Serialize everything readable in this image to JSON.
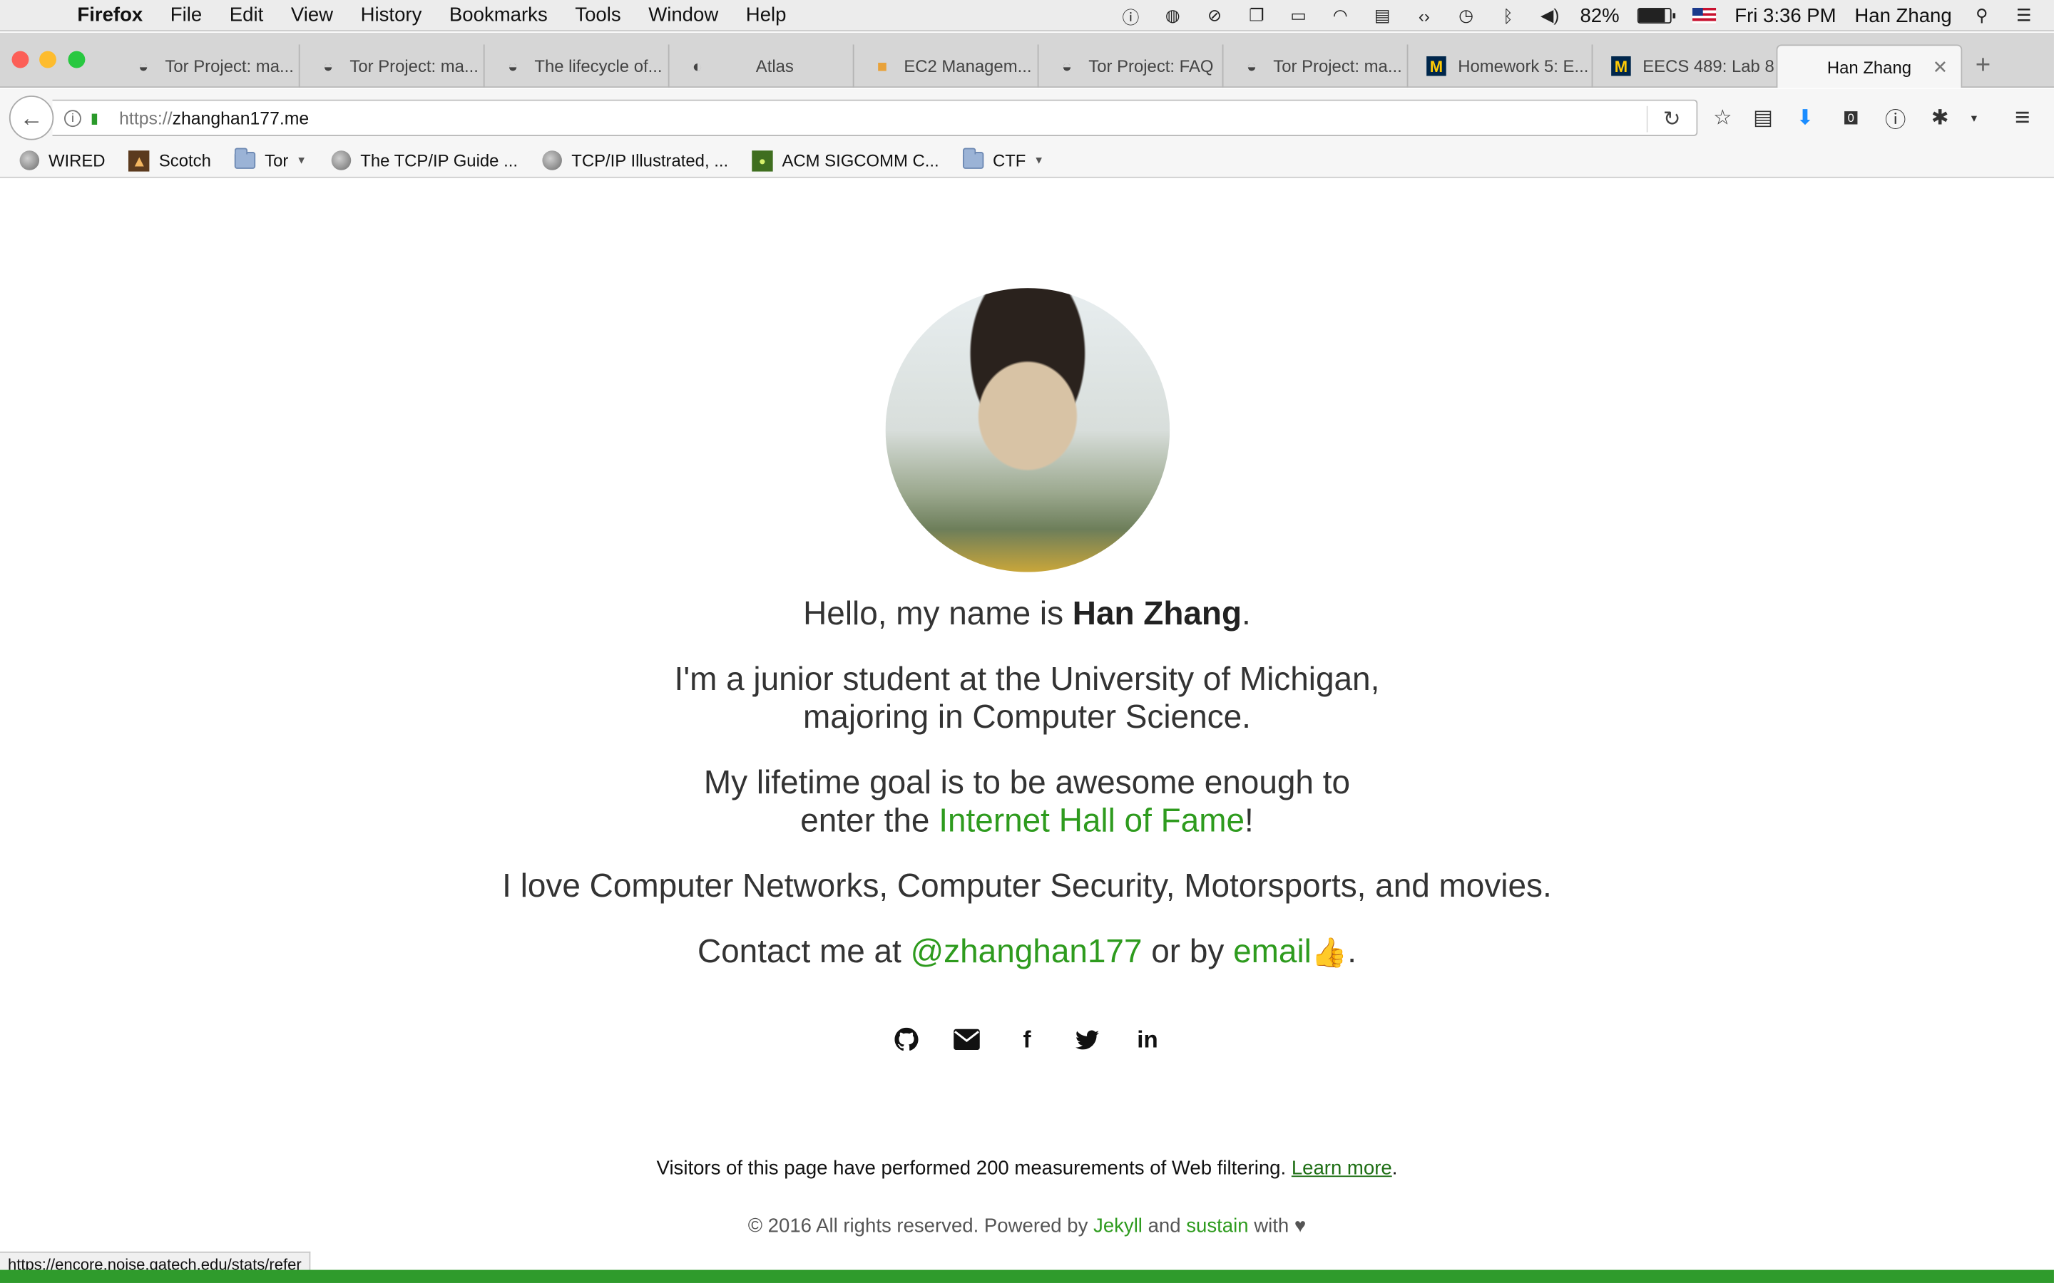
{
  "menubar": {
    "app": "Firefox",
    "items": [
      "File",
      "Edit",
      "View",
      "History",
      "Bookmarks",
      "Tools",
      "Window",
      "Help"
    ],
    "battery": "82%",
    "battery_level": 0.82,
    "clock": "Fri 3:36 PM",
    "user": "Han Zhang"
  },
  "tabs": [
    {
      "title": "Tor Project: ma...",
      "icon": "tor-onion-icon"
    },
    {
      "title": "Tor Project: ma...",
      "icon": "tor-onion-icon"
    },
    {
      "title": "The lifecycle of...",
      "icon": "tor-onion-icon"
    },
    {
      "title": "Atlas",
      "icon": "atlas-globe-icon"
    },
    {
      "title": "EC2 Managem...",
      "icon": "aws-cube-icon"
    },
    {
      "title": "Tor Project: FAQ",
      "icon": "tor-onion-icon"
    },
    {
      "title": "Tor Project: ma...",
      "icon": "tor-onion-icon"
    },
    {
      "title": "Homework 5: E...",
      "icon": "michigan-m-icon"
    },
    {
      "title": "EECS 489: Lab 8",
      "icon": "michigan-m-icon"
    }
  ],
  "active_tab": {
    "title": "Han Zhang"
  },
  "address": {
    "protocol": "https://",
    "host": "zhanghan177.me"
  },
  "toolbar": {
    "download_count": "0"
  },
  "bookmarks": [
    {
      "label": "WIRED",
      "icon": "globe-icon"
    },
    {
      "label": "Scotch",
      "icon": "scotch-icon"
    },
    {
      "label": "Tor",
      "icon": "folder-icon",
      "folder": true
    },
    {
      "label": "The TCP/IP Guide ...",
      "icon": "globe-icon"
    },
    {
      "label": "TCP/IP Illustrated, ...",
      "icon": "globe-icon"
    },
    {
      "label": "ACM SIGCOMM C...",
      "icon": "sigcomm-icon"
    },
    {
      "label": "CTF",
      "icon": "folder-icon",
      "folder": true
    }
  ],
  "page": {
    "greeting_pre": "Hello, my name is ",
    "name": "Han Zhang",
    "greeting_post": ".",
    "line2a": "I'm a junior student at the University of Michigan,",
    "line2b": "majoring in Computer Science.",
    "line3a": "My lifetime goal is to be awesome enough to",
    "line3b_pre": "enter the ",
    "line3b_link": "Internet Hall of Fame",
    "line3b_post": "!",
    "line4": "I love Computer Networks, Computer Security, Motorsports, and movies.",
    "contact_pre": "Contact me at ",
    "contact_handle": "@zhanghan177",
    "contact_mid": " or by ",
    "contact_email": "email",
    "contact_post": ".",
    "social": [
      "github-icon",
      "email-icon",
      "facebook-icon",
      "twitter-icon",
      "linkedin-icon"
    ]
  },
  "footer": {
    "measure_text": "Visitors of this page have performed 200 measurements of Web filtering. ",
    "learn_more": "Learn more",
    "measure_post": ".",
    "copyright_pre": "© 2016 All rights reserved. Powered by ",
    "jekyll": "Jekyll",
    "and": " and ",
    "sustain": "sustain",
    "with": " with ♥"
  },
  "status_url": "https://encore.noise.gatech.edu/stats/refer"
}
